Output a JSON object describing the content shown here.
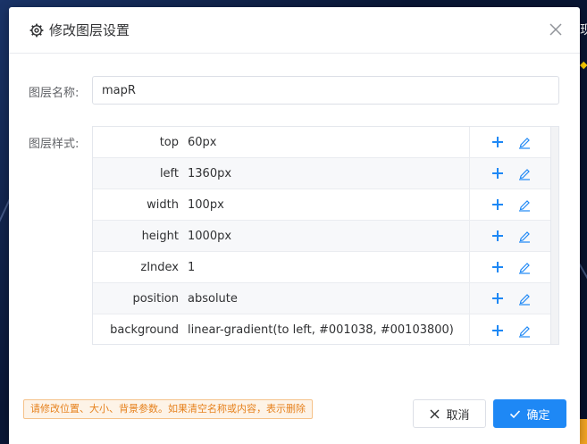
{
  "dialog": {
    "title": "修改图层设置",
    "name_label": "图层名称:",
    "name_value": "mapR",
    "style_label": "图层样式:",
    "styles": [
      {
        "key": "top",
        "value": "60px"
      },
      {
        "key": "left",
        "value": "1360px"
      },
      {
        "key": "width",
        "value": "100px"
      },
      {
        "key": "height",
        "value": "1000px"
      },
      {
        "key": "zIndex",
        "value": "1"
      },
      {
        "key": "position",
        "value": "absolute"
      },
      {
        "key": "background",
        "value": "linear-gradient(to left, #001038, #00103800)"
      }
    ],
    "tip": "请修改位置、大小、背景参数。如果清空名称或内容，表示删除",
    "cancel_label": "取消",
    "ok_label": "确定"
  },
  "background": {
    "edge_char": "现"
  },
  "colors": {
    "accent": "#1e88f5",
    "tip_text": "#e6821e",
    "tip_border": "#f5c28a"
  },
  "icons": {
    "header": "gear-icon",
    "close": "close-icon",
    "add": "plus-icon",
    "edit": "edit-icon",
    "cancel": "x-icon",
    "ok": "check-icon"
  }
}
